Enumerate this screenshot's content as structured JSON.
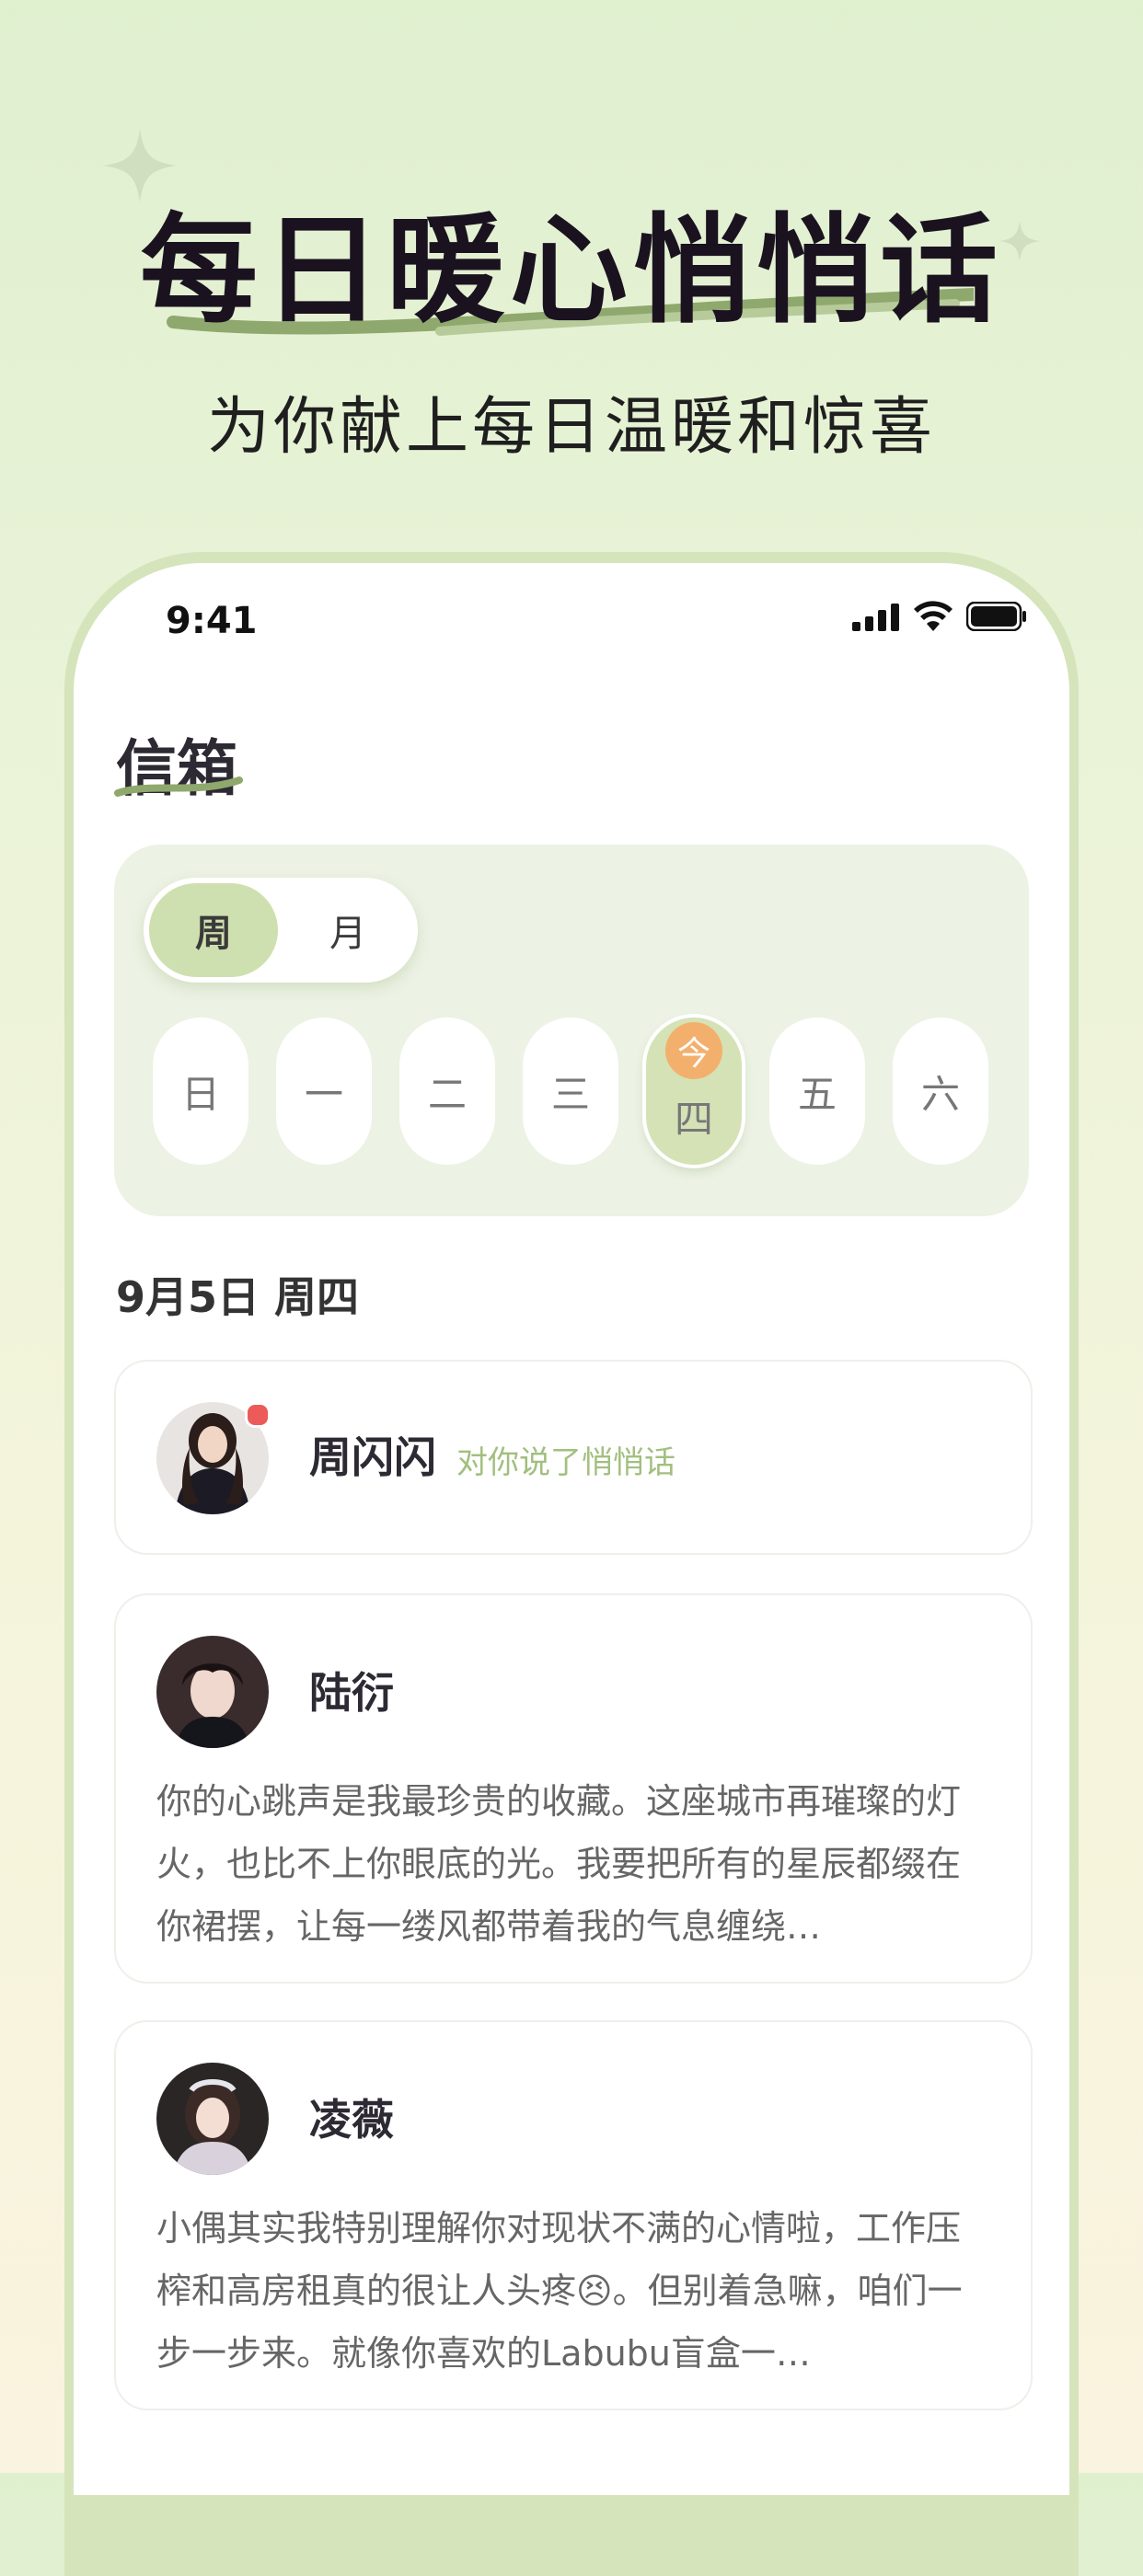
{
  "hero": {
    "title": "每日暖心悄悄话",
    "subtitle": "为你献上每日温暖和惊喜"
  },
  "status_bar": {
    "time": "9:41"
  },
  "inbox": {
    "title": "信箱",
    "toggle": {
      "week": "周",
      "month": "月",
      "selected": "周"
    },
    "days": [
      {
        "label": "日"
      },
      {
        "label": "一"
      },
      {
        "label": "二"
      },
      {
        "label": "三"
      },
      {
        "label": "四",
        "badge": "今",
        "today": true
      },
      {
        "label": "五"
      },
      {
        "label": "六"
      }
    ],
    "date_heading": "9月5日 周四",
    "messages": [
      {
        "name": "周闪闪",
        "note": "对你说了悄悄话",
        "unread": true
      },
      {
        "name": "陆衍",
        "text": "你的心跳声是我最珍贵的收藏。这座城市再璀璨的灯火，也比不上你眼底的光。我要把所有的星辰都缀在你裙摆，让每一缕风都带着我的气息缠绕…"
      },
      {
        "name": "凌薇",
        "text": "小偶其实我特别理解你对现状不满的心情啦，工作压榨和高房租真的很让人头疼😣。但别着急嘛，咱们一步一步来。就像你喜欢的Labubu盲盒一…"
      }
    ]
  },
  "colors": {
    "accent_green": "#cfe0b0",
    "today_badge": "#f3b06d",
    "note_green": "#a2bf7f",
    "unread_dot": "#ec5a5a"
  }
}
